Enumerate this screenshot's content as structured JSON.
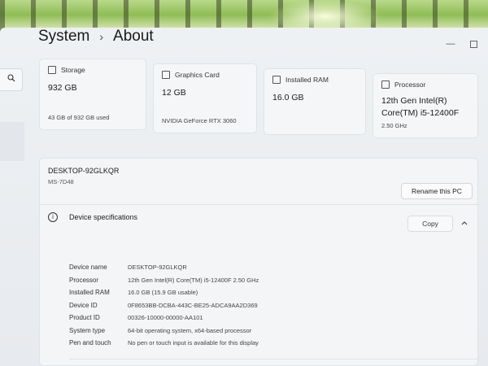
{
  "breadcrumb": {
    "parent": "System",
    "separator": "›",
    "current": "About"
  },
  "cards": [
    {
      "label": "Storage",
      "value": "932 GB",
      "sub": "43 GB of 932 GB used"
    },
    {
      "label": "Graphics Card",
      "value": "12 GB",
      "sub": "NVIDIA GeForce RTX 3060"
    },
    {
      "label": "Installed RAM",
      "value": "16.0 GB",
      "sub": ""
    },
    {
      "label": "Processor",
      "value": "12th Gen Intel(R) Core(TM) i5-12400F",
      "sub": "2.50 GHz"
    }
  ],
  "device": {
    "name": "DESKTOP-92GLKQR",
    "model": "MS-7D48",
    "rename_label": "Rename this PC"
  },
  "specs": {
    "title": "Device specifications",
    "copy_label": "Copy",
    "rows": [
      {
        "key": "Device name",
        "value": "DESKTOP-92GLKQR"
      },
      {
        "key": "Processor",
        "value": "12th Gen Intel(R) Core(TM) i5-12400F   2.50 GHz"
      },
      {
        "key": "Installed RAM",
        "value": "16.0 GB (15.9 GB usable)"
      },
      {
        "key": "Device ID",
        "value": "0F8653BB-DCBA-443C-BE25-ADCA9AA2D369"
      },
      {
        "key": "Product ID",
        "value": "00326-10000-00000-AA101"
      },
      {
        "key": "System type",
        "value": "64-bit operating system, x64-based processor"
      },
      {
        "key": "Pen and touch",
        "value": "No pen or touch input is available for this display"
      }
    ]
  },
  "window": {
    "minimize_glyph": "—",
    "maximize_glyph": ""
  }
}
